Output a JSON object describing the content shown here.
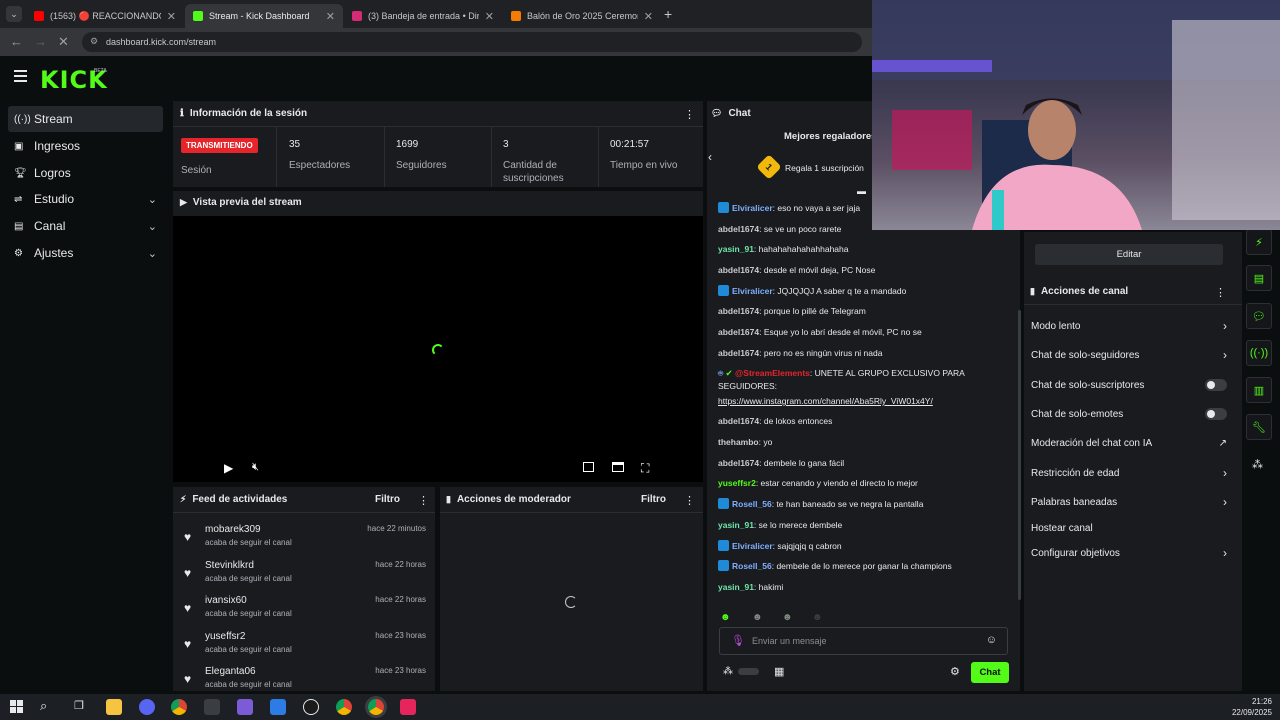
{
  "browser": {
    "tabs": [
      {
        "label": "(1563) 🔴 REACCIONANDO A I",
        "favicon_color": "#ff0000"
      },
      {
        "label": "Stream - Kick Dashboard",
        "favicon_color": "#53fc18"
      },
      {
        "label": "(3) Bandeja de entrada • Direct",
        "favicon_color": "#d62976"
      },
      {
        "label": "Balón de Oro 2025 Ceremonia E",
        "favicon_color": "#f57c00"
      }
    ],
    "url": "dashboard.kick.com/stream"
  },
  "brand": {
    "logo": "KICK",
    "tag": "BETA",
    "accent": "#53fc18"
  },
  "sidebar": {
    "items": [
      {
        "label": "Stream",
        "icon": "broadcast-icon"
      },
      {
        "label": "Ingresos",
        "icon": "wallet-icon"
      },
      {
        "label": "Logros",
        "icon": "trophy-icon"
      },
      {
        "label": "Estudio",
        "icon": "studio-icon"
      },
      {
        "label": "Canal",
        "icon": "channel-icon"
      },
      {
        "label": "Ajustes",
        "icon": "gear-icon"
      }
    ]
  },
  "session": {
    "title": "Información de la sesión",
    "live_badge": "TRANSMITIENDO",
    "session_label": "Sesión",
    "stats": [
      {
        "value": "35",
        "label": "Espectadores"
      },
      {
        "value": "1699",
        "label": "Seguidores"
      },
      {
        "value": "3",
        "label": "Cantidad de suscripciones"
      },
      {
        "value": "00:21:57",
        "label": "Tiempo en vivo"
      }
    ]
  },
  "preview": {
    "title": "Vista previa del stream"
  },
  "feed": {
    "title": "Feed de actividades",
    "filter": "Filtro",
    "items": [
      {
        "name": "mobarek309",
        "action": "acaba de seguir el canal",
        "time": "hace 22 minutos"
      },
      {
        "name": "Stevinklkrd",
        "action": "acaba de seguir el canal",
        "time": "hace 22 horas"
      },
      {
        "name": "ivansix60",
        "action": "acaba de seguir el canal",
        "time": "hace 22 horas"
      },
      {
        "name": "yuseffsr2",
        "action": "acaba de seguir el canal",
        "time": "hace 23 horas"
      },
      {
        "name": "Eleganta06",
        "action": "acaba de seguir el canal",
        "time": "hace 23 horas"
      }
    ]
  },
  "mod": {
    "title": "Acciones de moderador",
    "filter": "Filtro"
  },
  "chat": {
    "title": "Chat",
    "top_gifters": "Mejores regaladores",
    "gift_rank": "1",
    "gift_text": "Regala 1 suscripción",
    "messages": [
      {
        "user": "Elviralicer",
        "color": "#7fb0ff",
        "badge": true,
        "text": "eso no vaya a ser jaja"
      },
      {
        "user": "abdel1674",
        "color": "#c8ccd2",
        "badge": false,
        "text": "se ve un poco rarete"
      },
      {
        "user": "yasin_91",
        "color": "#6ee7a8",
        "badge": false,
        "text": "hahahahahahahhahaha"
      },
      {
        "user": "abdel1674",
        "color": "#c8ccd2",
        "badge": false,
        "text": "desde el móvil deja, PC Nose"
      },
      {
        "user": "Elviralicer",
        "color": "#7fb0ff",
        "badge": true,
        "text": "JQJQJQJ A saber q te a mandado"
      },
      {
        "user": "abdel1674",
        "color": "#c8ccd2",
        "badge": false,
        "text": "porque lo pillé de Telegram"
      },
      {
        "user": "abdel1674",
        "color": "#c8ccd2",
        "badge": false,
        "text": "Esque yo lo abrí desde el móvil, PC no se"
      },
      {
        "user": "abdel1674",
        "color": "#c8ccd2",
        "badge": false,
        "text": "pero no es ningún virus ni nada"
      }
    ],
    "se_user": "@StreamElements",
    "se_text": "UNETE AL GRUPO EXCLUSIVO PARA SEGUIDORES:",
    "se_link": "https://www.instagram.com/channel/Aba5Rly_ViW01x4Y/",
    "messages2": [
      {
        "user": "abdel1674",
        "color": "#c8ccd2",
        "badge": false,
        "text": "de lokos entonces"
      },
      {
        "user": "thehambo",
        "color": "#c8ccd2",
        "badge": false,
        "text": "yo"
      },
      {
        "user": "abdel1674",
        "color": "#c8ccd2",
        "badge": false,
        "text": "dembele lo gana fácil"
      },
      {
        "user": "yuseffsr2",
        "color": "#53fc18",
        "badge": false,
        "text": "estar cenando y viendo el directo lo mejor"
      },
      {
        "user": "Rosell_56",
        "color": "#7fb0ff",
        "badge": true,
        "text": "te han baneado se ve negra la pantalla"
      },
      {
        "user": "yasin_91",
        "color": "#6ee7a8",
        "badge": false,
        "text": "se lo merece dembele"
      },
      {
        "user": "Elviralicer",
        "color": "#7fb0ff",
        "badge": true,
        "text": "sajqjqjq q cabron"
      },
      {
        "user": "Rosell_56",
        "color": "#7fb0ff",
        "badge": true,
        "text": "dembele de lo merece por ganar la champions"
      },
      {
        "user": "yasin_91",
        "color": "#6ee7a8",
        "badge": false,
        "text": "hakimi"
      }
    ],
    "input_placeholder": "Enviar un mensaje",
    "send_label": "Chat"
  },
  "right": {
    "edit_label": "Editar",
    "actions_title": "Acciones de canal",
    "actions": [
      {
        "label": "Modo lento",
        "kind": "arrow"
      },
      {
        "label": "Chat de solo-seguidores",
        "kind": "arrow"
      },
      {
        "label": "Chat de solo-suscriptores",
        "kind": "toggle"
      },
      {
        "label": "Chat de solo-emotes",
        "kind": "toggle"
      },
      {
        "label": "Moderación del chat con IA",
        "kind": "external"
      },
      {
        "label": "Restricción de edad",
        "kind": "arrow"
      },
      {
        "label": "Palabras baneadas",
        "kind": "arrow"
      },
      {
        "label": "Hostear canal",
        "kind": "none"
      },
      {
        "label": "Configurar objetivos",
        "kind": "arrow"
      }
    ]
  },
  "taskbar": {
    "time": "21:26",
    "date": "22/09/2025"
  }
}
